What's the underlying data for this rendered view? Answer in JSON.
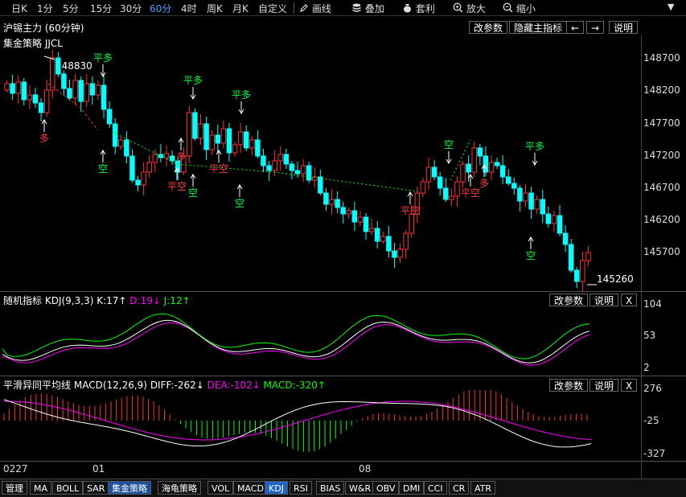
{
  "toolbar": {
    "periods": [
      "日K",
      "1分",
      "5分",
      "15分",
      "30分",
      "60分",
      "4时",
      "周K",
      "月K",
      "自定义"
    ],
    "active_period": "60分",
    "tools": [
      {
        "icon": "pencil-icon",
        "label": "画线"
      },
      {
        "icon": "layers-icon",
        "label": "叠加"
      },
      {
        "icon": "bag-icon",
        "label": "套利"
      },
      {
        "icon": "zoom-in-icon",
        "label": "放大"
      },
      {
        "icon": "zoom-out-icon",
        "label": "缩小"
      }
    ]
  },
  "main_panel": {
    "symbol": "沪锡主力 (60分钟)",
    "strategy": "集金策略 JJCL",
    "buttons": [
      "改参数",
      "隐藏主指标",
      "说明"
    ],
    "arrow_left": "←",
    "arrow_right": "→",
    "y_ticks": [
      "148700",
      "148200",
      "147700",
      "147200",
      "146700",
      "146200",
      "145700"
    ],
    "high_label": "148830",
    "low_label": "145260",
    "signals": {
      "buy": "多",
      "short": "空",
      "close_long": "平多",
      "close_short": "平空"
    }
  },
  "kdj_panel": {
    "name": "随机指标",
    "formula": "KDJ(9,3,3)",
    "k": "K:17↑",
    "d": "D:19↓",
    "j": "J:12↑",
    "buttons": [
      "改参数",
      "说明",
      "X"
    ],
    "y_ticks": [
      "104",
      "53",
      "2"
    ]
  },
  "macd_panel": {
    "name": "平滑异同平均线",
    "formula": "MACD(12,26,9)",
    "diff": "DIFF:-262↓",
    "dea": "DEA:-102↓",
    "macd": "MACD:-320↑",
    "buttons": [
      "改参数",
      "说明",
      "X"
    ],
    "y_ticks": [
      "276",
      "-25",
      "-327"
    ]
  },
  "x_labels": [
    "0227",
    "01",
    "08"
  ],
  "bottom_tabs": [
    "管理",
    "MA",
    "BOLL",
    "SAR",
    "集金策略",
    "海龟策略",
    "VOL",
    "MACD",
    "KDJ",
    "RSI",
    "BIAS",
    "W&R",
    "OBV",
    "DMI",
    "CCI",
    "CR",
    "ATR"
  ],
  "active_tab": "集金策略",
  "highlight_tab": "KDJ",
  "colors": {
    "up": "#ff3232",
    "down": "#00ffff",
    "buy": "#ff3c3c",
    "short": "#00ff3c",
    "kdj_k": "#ffffff",
    "kdj_d": "#ff00ff",
    "kdj_j": "#00ff00",
    "dashed_red": "#ff3232",
    "dashed_green": "#00ff00"
  },
  "chart_data": [
    {
      "type": "candlestick",
      "title": "沪锡主力 (60分钟)",
      "y_range": [
        145200,
        148900
      ],
      "annotations": {
        "high": 148830,
        "low": 145260
      }
    },
    {
      "type": "line",
      "title": "KDJ(9,3,3)",
      "series": [
        {
          "name": "K"
        },
        {
          "name": "D"
        },
        {
          "name": "J"
        }
      ],
      "ylim": [
        2,
        104
      ]
    },
    {
      "type": "bar",
      "title": "MACD(12,26,9)",
      "series": [
        {
          "name": "DIFF"
        },
        {
          "name": "DEA"
        },
        {
          "name": "MACD"
        }
      ],
      "ylim": [
        -327,
        276
      ]
    }
  ]
}
